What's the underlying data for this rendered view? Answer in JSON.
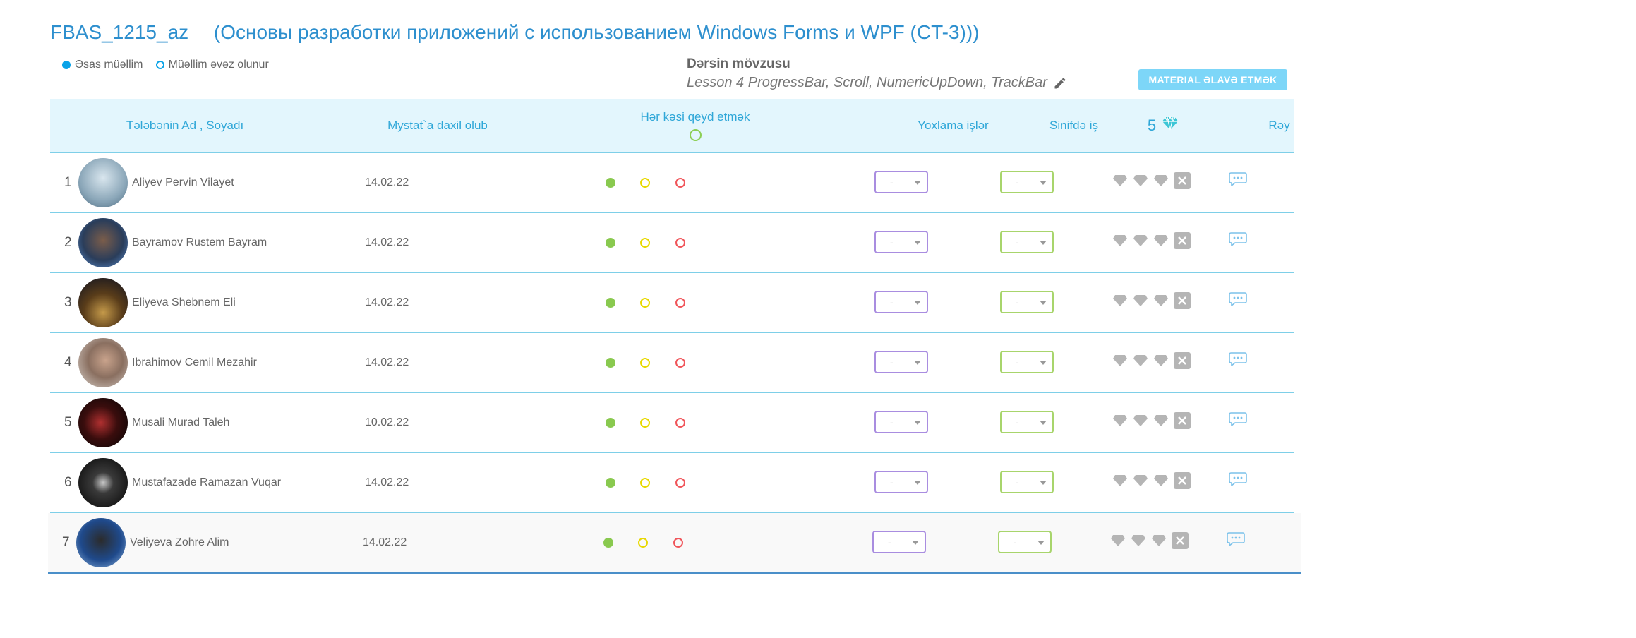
{
  "header": {
    "group": "FBAS_1215_az",
    "course": "(Основы разработки приложений с использованием Windows Forms и WPF (CT-3)))"
  },
  "legend": {
    "main_teacher": "Əsas müəllim",
    "substitute_teacher": "Müəllim əvəz olunur"
  },
  "topic": {
    "label": "Dərsin mövzusu",
    "value": "Lesson 4 ProgressBar, Scroll, NumericUpDown, TrackBar"
  },
  "material_button": "MATERIAL ƏLAVƏ ETMƏK",
  "table": {
    "columns": {
      "name": "Tələbənin Ad , Soyadı",
      "joined": "Mystat`a daxil olub",
      "attendance": "Hər kəsi qeyd etmək",
      "homework": "Yoxlama işlər",
      "classwork": "Sinifdə iş",
      "gems": "5",
      "feedback": "Rəy"
    },
    "select_placeholder": "-",
    "rows": [
      {
        "num": "1",
        "name": "Aliyev Pervin Vilayet",
        "date": "14.02.22"
      },
      {
        "num": "2",
        "name": "Bayramov Rustem Bayram",
        "date": "14.02.22"
      },
      {
        "num": "3",
        "name": "Eliyeva Shebnem Eli",
        "date": "14.02.22"
      },
      {
        "num": "4",
        "name": "Ibrahimov Cemil Mezahir",
        "date": "14.02.22"
      },
      {
        "num": "5",
        "name": "Musali Murad Taleh",
        "date": "10.02.22"
      },
      {
        "num": "6",
        "name": "Mustafazade Ramazan Vuqar",
        "date": "14.02.22"
      },
      {
        "num": "7",
        "name": "Veliyeva Zohre Alim",
        "date": "14.02.22"
      }
    ]
  },
  "colors": {
    "accent": "#2d8fce",
    "header_bg": "#e3f6fd",
    "present": "#89c94f",
    "late": "#e8d800",
    "absent": "#f0555a"
  }
}
